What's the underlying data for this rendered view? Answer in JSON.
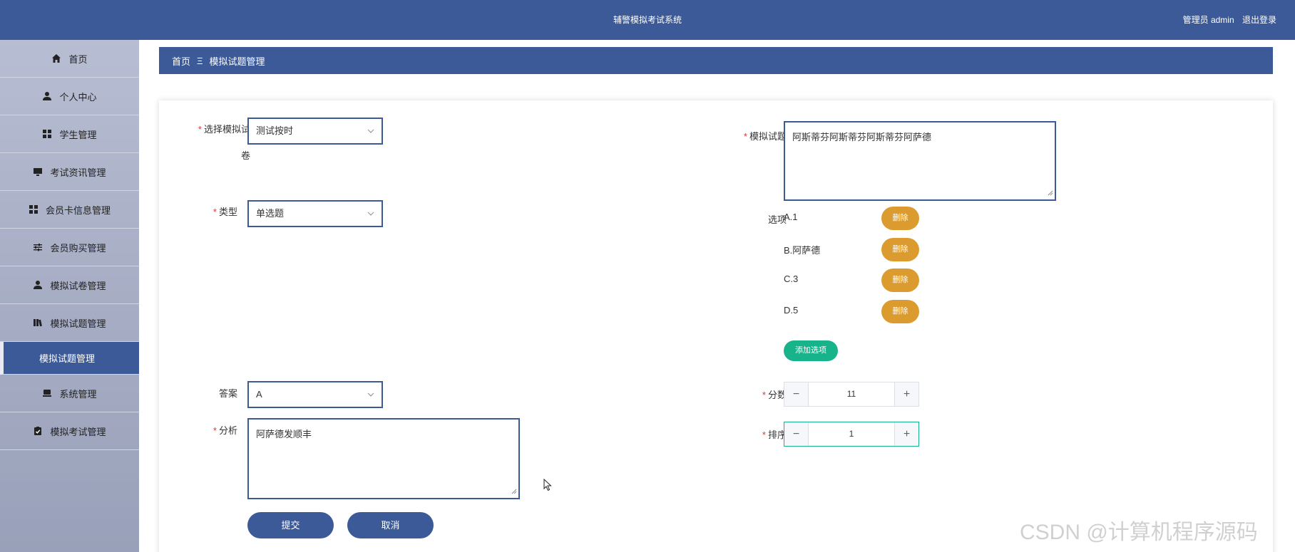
{
  "header": {
    "title": "辅警模拟考试系统",
    "user_label": "管理员 admin",
    "logout_label": "退出登录"
  },
  "sidebar": {
    "items": [
      {
        "label": "首页",
        "icon": "home-icon"
      },
      {
        "label": "个人中心",
        "icon": "user-icon"
      },
      {
        "label": "学生管理",
        "icon": "grid-icon"
      },
      {
        "label": "考试资讯管理",
        "icon": "monitor-icon"
      },
      {
        "label": "会员卡信息管理",
        "icon": "grid-icon"
      },
      {
        "label": "会员购买管理",
        "icon": "sliders-icon"
      },
      {
        "label": "模拟试卷管理",
        "icon": "user-icon"
      },
      {
        "label": "模拟试题管理",
        "icon": "book-icon"
      }
    ],
    "active_sub": "模拟试题管理",
    "items_bottom": [
      {
        "label": "系统管理",
        "icon": "computer-icon"
      },
      {
        "label": "模拟考试管理",
        "icon": "clipboard-icon"
      }
    ]
  },
  "breadcrumb": {
    "home": "首页",
    "separator": "Ξ",
    "current": "模拟试题管理"
  },
  "form": {
    "paper": {
      "label_line1": "选择模拟试",
      "label_line2": "卷",
      "value": "测试按时"
    },
    "type": {
      "label": "类型",
      "value": "单选题"
    },
    "answer": {
      "label": "答案",
      "value": "A"
    },
    "analysis": {
      "label": "分析",
      "value": "阿萨德发顺丰"
    },
    "question": {
      "label": "模拟试题",
      "value": "阿斯蒂芬阿斯蒂芬阿斯蒂芬阿萨德"
    },
    "options": {
      "label": "选项",
      "items": [
        "A.1",
        "B.阿萨德",
        "C.3",
        "D.5"
      ],
      "delete_label": "删除",
      "add_label": "添加选项"
    },
    "score": {
      "label": "分数",
      "value": "11"
    },
    "order": {
      "label": "排序",
      "value": "1"
    },
    "submit_label": "提交",
    "cancel_label": "取消"
  },
  "watermark": "CSDN @计算机程序源码",
  "colors": {
    "primary": "#3d5a98",
    "delete": "#dc9b2e",
    "add": "#17b38a",
    "required": "#e0342d"
  }
}
